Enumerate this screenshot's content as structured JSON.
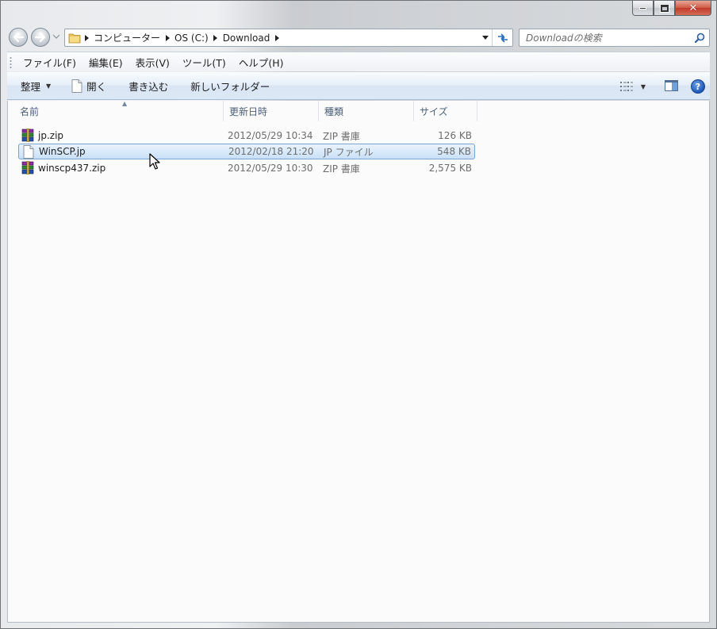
{
  "window": {
    "caption": {
      "minimize_symbol": "—",
      "maximize_symbol": "□",
      "close_symbol": "✕"
    }
  },
  "nav": {
    "back_icon": "back-arrow-icon",
    "forward_icon": "forward-arrow-icon",
    "breadcrumbs": [
      "コンピューター",
      "OS (C:)",
      "Download"
    ],
    "search_placeholder": "Downloadの検索"
  },
  "menu": {
    "items": [
      "ファイル(F)",
      "編集(E)",
      "表示(V)",
      "ツール(T)",
      "ヘルプ(H)"
    ]
  },
  "toolbar": {
    "organize_label": "整理",
    "open_label": "開く",
    "burn_label": "書き込む",
    "new_folder_label": "新しいフォルダー",
    "help_symbol": "?"
  },
  "columns": {
    "name": "名前",
    "date": "更新日時",
    "type": "種類",
    "size": "サイズ"
  },
  "files": [
    {
      "name": "jp.zip",
      "date": "2012/05/29 10:34",
      "type": "ZIP 書庫",
      "size": "126 KB",
      "icon": "winrar-archive-icon",
      "selected": false
    },
    {
      "name": "WinSCP.jp",
      "date": "2012/02/18 21:20",
      "type": "JP ファイル",
      "size": "548 KB",
      "icon": "blank-file-icon",
      "selected": true
    },
    {
      "name": "winscp437.zip",
      "date": "2012/05/29 10:30",
      "type": "ZIP 書庫",
      "size": "2,575 KB",
      "icon": "winrar-archive-icon",
      "selected": false
    }
  ]
}
